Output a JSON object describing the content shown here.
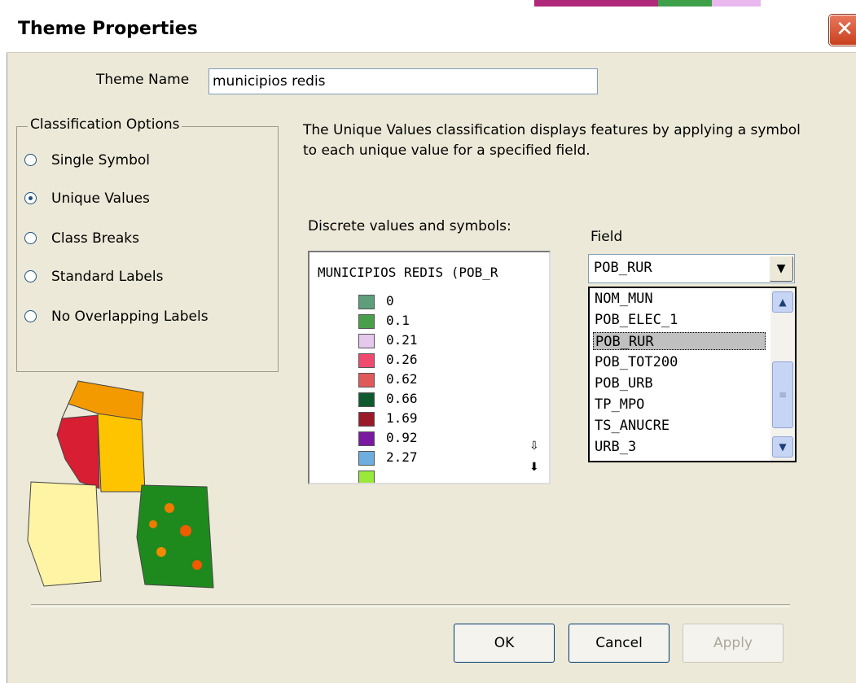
{
  "window": {
    "title": "Theme Properties",
    "close_glyph": "✕"
  },
  "theme_name": {
    "label": "Theme Name",
    "value": "municipios redis"
  },
  "classification": {
    "title": "Classification Options",
    "options": [
      {
        "label": "Single Symbol",
        "selected": false
      },
      {
        "label": "Unique Values",
        "selected": true
      },
      {
        "label": "Class Breaks",
        "selected": false
      },
      {
        "label": "Standard Labels",
        "selected": false
      },
      {
        "label": "No Overlapping Labels",
        "selected": false
      }
    ]
  },
  "description": "The Unique Values classification displays features by applying a symbol to each unique value for a specified field.",
  "discrete": {
    "label": "Discrete values and symbols:",
    "header": "MUNICIPIOS REDIS (POB_R",
    "items": [
      {
        "value": "0",
        "color": "#5e9e7a"
      },
      {
        "value": "0.1",
        "color": "#4aa04a"
      },
      {
        "value": "0.21",
        "color": "#e6c8ec"
      },
      {
        "value": "0.26",
        "color": "#f04a6e"
      },
      {
        "value": "0.62",
        "color": "#e05a5a"
      },
      {
        "value": "0.66",
        "color": "#0e5a2e"
      },
      {
        "value": "1.69",
        "color": "#9a1a2a"
      },
      {
        "value": "0.92",
        "color": "#7a1aa0"
      },
      {
        "value": "2.27",
        "color": "#6eaede"
      }
    ]
  },
  "field": {
    "label": "Field",
    "selected": "POB_RUR",
    "options": [
      "NOM_MUN",
      "POB_ELEC_1",
      "POB_RUR",
      "POB_TOT200",
      "POB_URB",
      "TP_MPO",
      "TS_ANUCRE",
      "URB_3"
    ]
  },
  "buttons": {
    "ok": "OK",
    "cancel": "Cancel",
    "apply": "Apply"
  }
}
